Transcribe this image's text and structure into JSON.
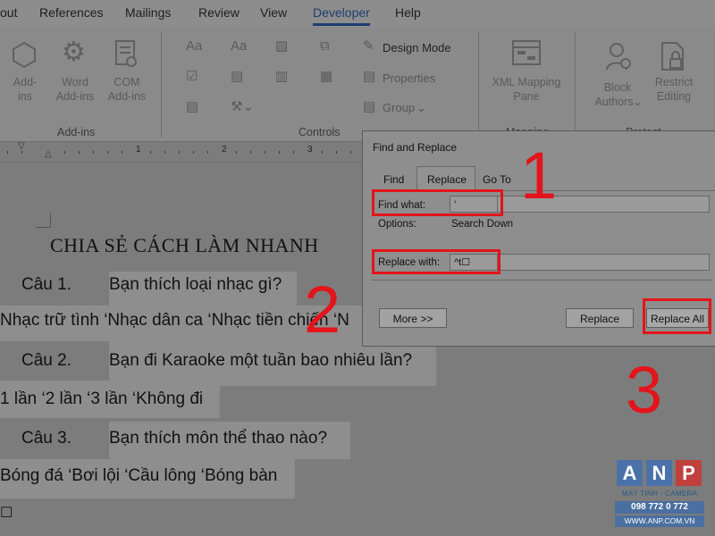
{
  "ribbon_tabs": [
    "out",
    "References",
    "Mailings",
    "Review",
    "View",
    "Developer",
    "Help"
  ],
  "active_tab": "Developer",
  "ribbon": {
    "addins_buttons": [
      {
        "icon": "hexagon-addins-icon",
        "label1": "Add-",
        "label2": "ins"
      },
      {
        "icon": "gear-icon",
        "label1": "Word",
        "label2": "Add-ins"
      },
      {
        "icon": "com-addins-icon",
        "label1": "COM",
        "label2": "Add-ins"
      }
    ],
    "addins_group": "Add-ins",
    "controls_group": "Controls",
    "design_mode": "Design Mode",
    "properties": "Properties",
    "group": "Group",
    "xml_mapping_1": "XML Mapping",
    "xml_mapping_2": "Pane",
    "mapping_group": "Mapping",
    "block_authors_1": "Block",
    "block_authors_2": "Authors",
    "restrict_editing_1": "Restrict",
    "restrict_editing_2": "Editing",
    "protect_group": "Protect"
  },
  "ruler": {
    "num1": "1",
    "num2": "2",
    "num3": "3"
  },
  "document": {
    "title": "CHIA SẺ CÁCH LÀM NHANH",
    "q1_label": "Câu 1.",
    "q1_text": "Bạn thích loại nhạc gì?",
    "q1_answers": "Nhạc trữ tình ‘Nhạc dân ca ‘Nhạc tiền chiến ‘N",
    "q2_label": "Câu 2.",
    "q2_text": "Bạn đi Karaoke một tuần bao nhiêu lần?",
    "q2_answers": "1 lần ‘2 lần ‘3 lần ‘Không đi",
    "q3_label": "Câu 3.",
    "q3_text": "Bạn thích môn thể thao nào?",
    "q3_answers": "Bóng đá ‘Bơi lội ‘Cầu lông ‘Bóng bàn",
    "trailing_mark": "☐"
  },
  "dialog": {
    "title": "Find and Replace",
    "tabs": [
      "Find",
      "Replace",
      "Go To"
    ],
    "active_tab": "Replace",
    "find_what_label": "Find what:",
    "find_what_value": "‘",
    "options_label": "Options:",
    "options_value": "Search Down",
    "replace_with_label": "Replace with:",
    "replace_with_value": "^t☐",
    "more_button": "More >>",
    "replace_button": "Replace",
    "replace_all_button": "Replace All"
  },
  "annotations": {
    "step1": "1",
    "step2": "2",
    "step3": "3",
    "color": "#e3141b"
  },
  "logo": {
    "letters": [
      "A",
      "N",
      "P"
    ],
    "tagline": "MÁY TÍNH - CAMERA",
    "phone": "098 772 0 772",
    "website": "WWW.ANP.COM.VN"
  }
}
